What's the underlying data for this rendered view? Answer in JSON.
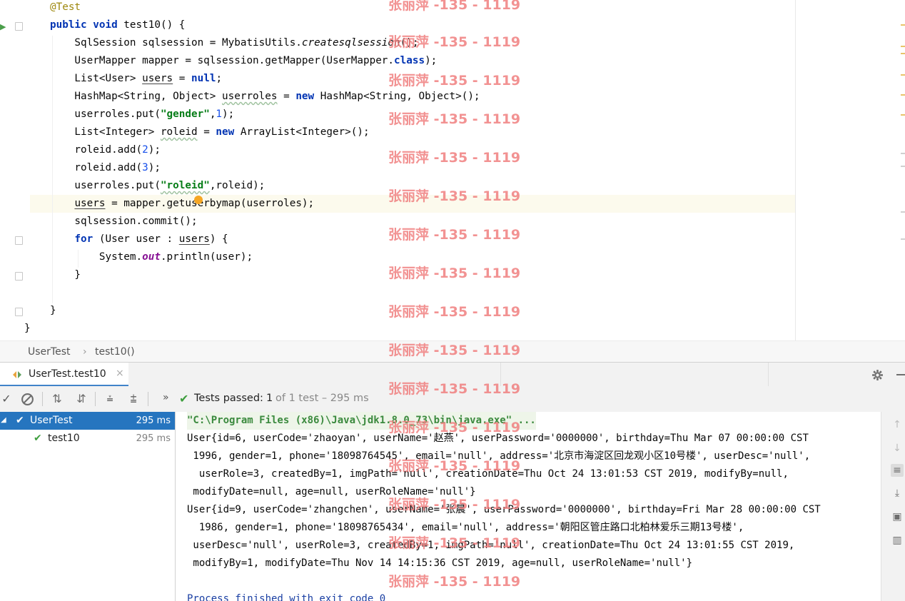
{
  "editor": {
    "lines": [
      [
        {
          "t": "@Test",
          "c": "ann"
        }
      ],
      [
        {
          "t": "public",
          "c": "kw"
        },
        {
          "t": " "
        },
        {
          "t": "void",
          "c": "kw"
        },
        {
          "t": " test10() {"
        }
      ],
      [
        {
          "t": "    SqlSession sqlsession = MybatisUtils."
        },
        {
          "t": "createsqlsession",
          "c": "ital"
        },
        {
          "t": "();"
        }
      ],
      [
        {
          "t": "    UserMapper mapper = sqlsession.getMapper(UserMapper."
        },
        {
          "t": "class",
          "c": "kw"
        },
        {
          "t": ");"
        }
      ],
      [
        {
          "t": "    List<User> "
        },
        {
          "t": "users",
          "c": "und"
        },
        {
          "t": " = "
        },
        {
          "t": "null",
          "c": "nul"
        },
        {
          "t": ";"
        }
      ],
      [
        {
          "t": "    HashMap<String, Object> "
        },
        {
          "t": "userroles",
          "c": "wavy"
        },
        {
          "t": " = "
        },
        {
          "t": "new",
          "c": "kw"
        },
        {
          "t": " HashMap<String, Object>();"
        }
      ],
      [
        {
          "t": "    userroles.put("
        },
        {
          "t": "\"gender\"",
          "c": "str"
        },
        {
          "t": ","
        },
        {
          "t": "1",
          "c": "num"
        },
        {
          "t": ");"
        }
      ],
      [
        {
          "t": "    List<Integer> "
        },
        {
          "t": "roleid",
          "c": "wavy"
        },
        {
          "t": " = "
        },
        {
          "t": "new",
          "c": "kw"
        },
        {
          "t": " ArrayList<Integer>();"
        }
      ],
      [
        {
          "t": "    roleid.add("
        },
        {
          "t": "2",
          "c": "num"
        },
        {
          "t": ");"
        }
      ],
      [
        {
          "t": "    roleid.add("
        },
        {
          "t": "3",
          "c": "num"
        },
        {
          "t": ");"
        }
      ],
      [
        {
          "t": "    userroles.put("
        },
        {
          "t": "\"roleid\"",
          "c": "str wavy"
        },
        {
          "t": ",roleid);"
        }
      ],
      [
        {
          "t": "    "
        },
        {
          "t": "users",
          "c": "und"
        },
        {
          "t": " = mapper.getuserbymap(userroles);"
        }
      ],
      [
        {
          "t": "    sqlsession.commit();"
        }
      ],
      [
        {
          "t": "    "
        },
        {
          "t": "for",
          "c": "kw"
        },
        {
          "t": " (User user : "
        },
        {
          "t": "users",
          "c": "und"
        },
        {
          "t": ") {"
        }
      ],
      [
        {
          "t": "        System."
        },
        {
          "t": "out",
          "c": "fld"
        },
        {
          "t": ".println(user);"
        }
      ],
      [
        {
          "t": "    }"
        }
      ],
      [
        {
          "t": ""
        }
      ],
      [
        {
          "t": "}"
        }
      ],
      [
        {
          "t": "}"
        }
      ]
    ]
  },
  "breadcrumb": {
    "class_name": "UserTest",
    "separator": "›",
    "method_name": "test10()"
  },
  "run_tab": {
    "label": "UserTest.test10",
    "close": "×"
  },
  "toolbar": {
    "status_label": "Tests passed:",
    "passed_count": "1",
    "status_detail": "of 1 test – 295 ms",
    "chevron": "»"
  },
  "tree": {
    "root": {
      "label": "UserTest",
      "time": "295 ms"
    },
    "child": {
      "label": "test10",
      "time": "295 ms"
    }
  },
  "console": {
    "command": "\"C:\\Program Files (x86)\\Java\\jdk1.8.0_73\\bin\\java.exe\" ...",
    "lines": [
      "User{id=6, userCode='zhaoyan', userName='赵燕', userPassword='0000000', birthday=Thu Mar 07 00:00:00 CST",
      " 1996, gender=1, phone='18098764545', email='null', address='北京市海淀区回龙观小区10号楼', userDesc='null',",
      "  userRole=3, createdBy=1, imgPath='null', creationDate=Thu Oct 24 13:01:53 CST 2019, modifyBy=null,",
      " modifyDate=null, age=null, userRoleName='null'}",
      "User{id=9, userCode='zhangchen', userName='张晨', userPassword='0000000', birthday=Fri Mar 28 00:00:00 CST",
      "  1986, gender=1, phone='18098765434', email='null', address='朝阳区管庄路口北柏林爱乐三期13号楼',",
      " userDesc='null', userRole=3, createdBy=1, imgPath='null', creationDate=Thu Oct 24 13:01:55 CST 2019,",
      " modifyBy=1, modifyDate=Thu Nov 14 14:15:36 CST 2019, age=null, userRoleName='null'}",
      "",
      "Process finished with exit code 0"
    ]
  },
  "watermark": "张丽萍 -135 - 1119",
  "colors": {
    "accent": "#2675bf",
    "pass": "#3e9e3e",
    "keyword": "#0033b3",
    "string": "#067d17"
  }
}
